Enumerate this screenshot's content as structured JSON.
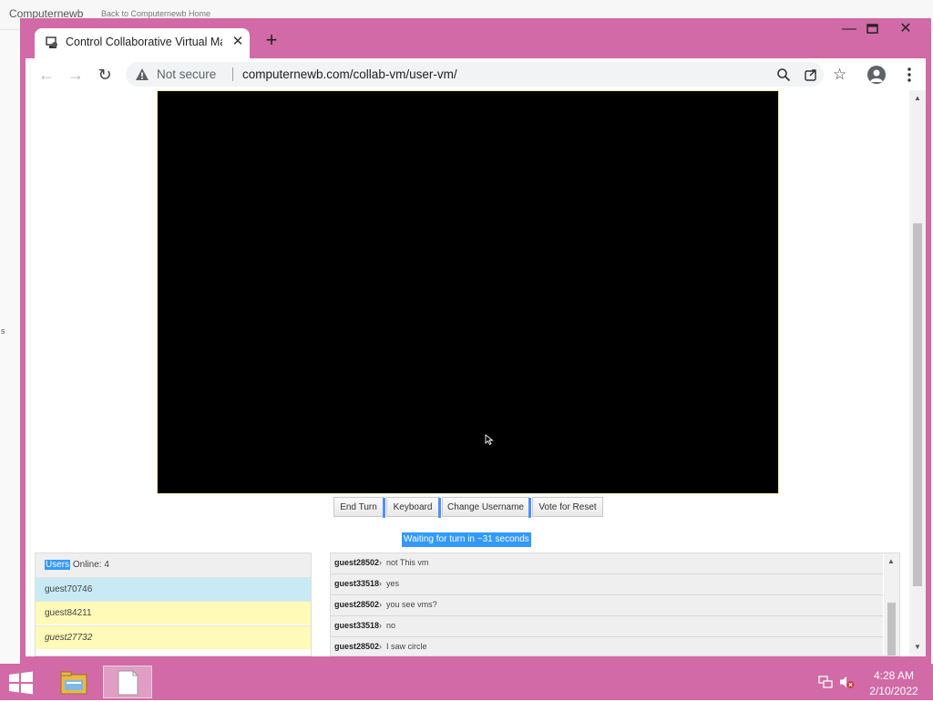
{
  "outer_site": {
    "brand": "Computernewb",
    "back_link": "Back to Computernewb Home",
    "edge_char": "s"
  },
  "browser": {
    "tab_title": "Control Collaborative Virtual Machine",
    "tab_close": "✕",
    "new_tab": "+",
    "window_controls": {
      "minimize": "—",
      "close": "✕"
    },
    "security_label": "Not secure",
    "url": "computernewb.com/collab-vm/user-vm/"
  },
  "vm": {
    "buttons": [
      "End Turn",
      "Keyboard",
      "Change Username",
      "Vote for Reset"
    ],
    "turn_status": "Waiting for turn in ~31 seconds"
  },
  "users": {
    "header_highlight": "Users",
    "header_rest": " Online: 4",
    "list": [
      {
        "name": "guest70746",
        "color": "#c8eaf5"
      },
      {
        "name": "guest84211",
        "color": "#fffab8"
      },
      {
        "name": "guest27732",
        "color": "#fffab8"
      }
    ]
  },
  "chat": {
    "messages": [
      {
        "user": "guest28502",
        "sep": "›",
        "text": "not This vm"
      },
      {
        "user": "guest33518",
        "sep": "›",
        "text": "yes"
      },
      {
        "user": "guest28502",
        "sep": "›",
        "text": "you see vms?"
      },
      {
        "user": "guest33518",
        "sep": "›",
        "text": "no"
      },
      {
        "user": "guest28502",
        "sep": "›",
        "text": "I saw circle"
      }
    ]
  },
  "taskbar": {
    "time": "4:28 AM",
    "date": "2/10/2022"
  },
  "colors": {
    "window_frame": "#d16aa6",
    "highlight": "#3399ff",
    "user_blue": "#c8eaf5",
    "user_yellow": "#fffab8"
  }
}
